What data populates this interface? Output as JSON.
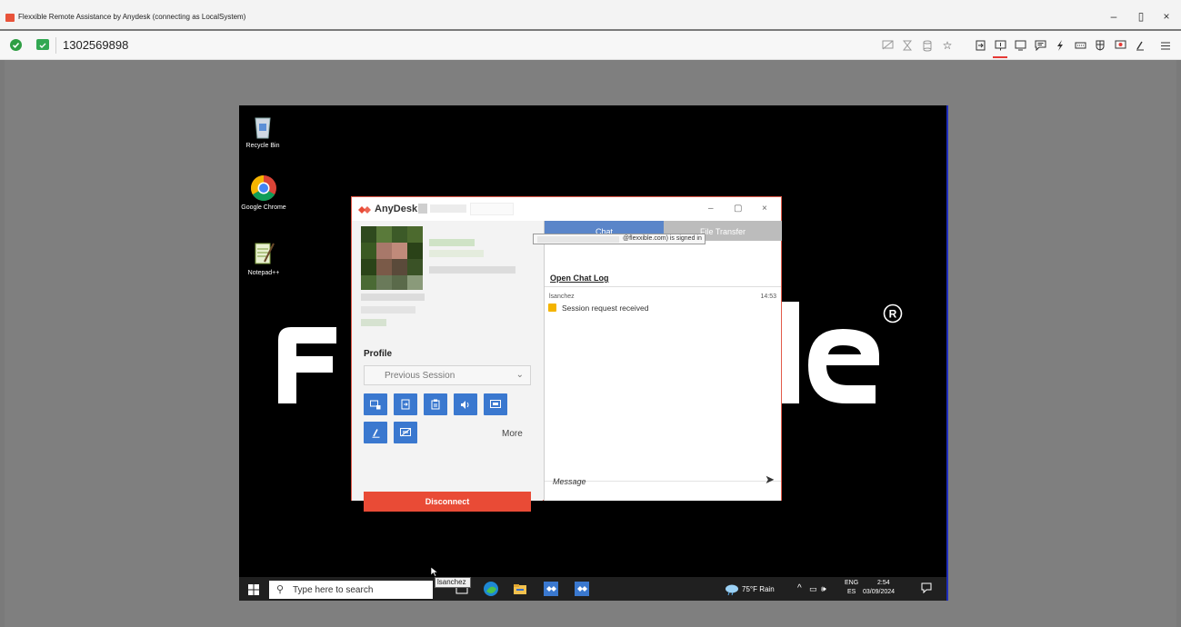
{
  "window": {
    "title": "Flexxible Remote Assistance by Anydesk (connecting as LocalSystem)",
    "minimize": "–",
    "restore": "▯",
    "close": "×"
  },
  "toolbar": {
    "session_id": "1302569898",
    "icons": [
      "display-off-icon",
      "hourglass-icon",
      "database-icon",
      "star-icon",
      "file-transfer-icon",
      "chat-request-icon",
      "display-icon",
      "chat-icon",
      "lightning-icon",
      "keyboard-icon",
      "privacy-icon",
      "record-icon",
      "whiteboard-icon",
      "menu-icon"
    ]
  },
  "desktop": {
    "recycle_bin": "Recycle Bin",
    "chrome": "Google Chrome",
    "notepad": "Notepad++",
    "brand_f": "F",
    "brand_le": "le",
    "brand_reg": "®"
  },
  "anydesk": {
    "title": "AnyDesk",
    "profile_label": "Profile",
    "session_select": "Previous Session",
    "more": "More",
    "disconnect": "Disconnect",
    "tabs": {
      "chat": "Chat",
      "file": "File Transfer"
    },
    "signed_in": "@flexxible.com) is signed in",
    "open_chat_log": "Open Chat Log",
    "message_user": "lsanchez",
    "message_time": "14:53",
    "message_text": "Session request received",
    "message_placeholder": "Message"
  },
  "taskbar": {
    "search_placeholder": "Type here to search",
    "tooltip": "lsanchez",
    "weather": "75°F  Rain",
    "lang_top": "ENG",
    "lang_bottom": "ES",
    "time": "2:54",
    "date": "03/09/2024"
  },
  "colors": {
    "anydesk_red": "#e94b36",
    "button_blue": "#3a78cf",
    "chat_tab_blue": "#5a85c9"
  }
}
